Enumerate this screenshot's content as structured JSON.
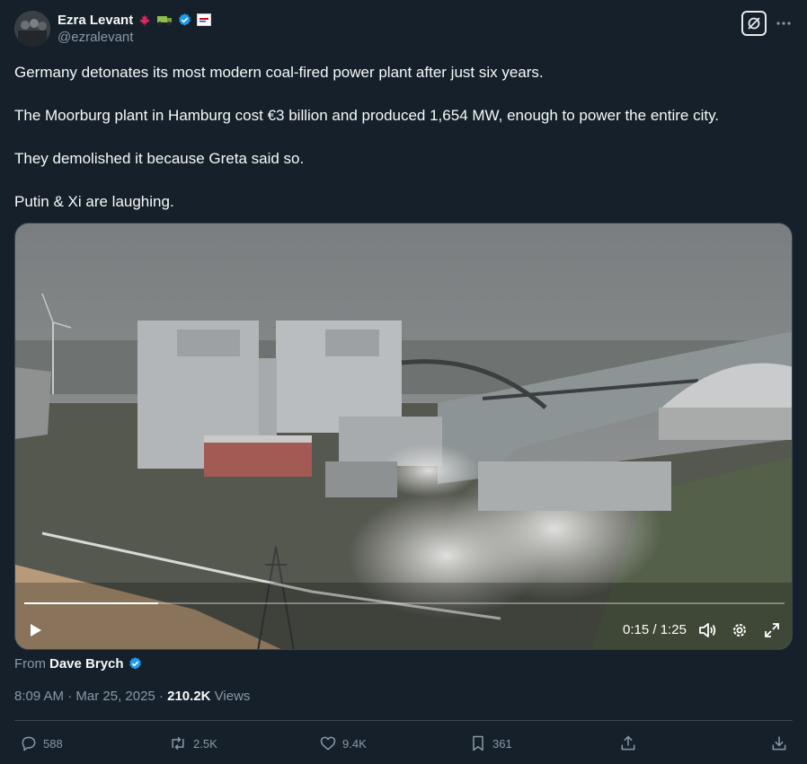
{
  "author": {
    "display_name": "Ezra Levant",
    "handle": "@ezralevant",
    "verified": true,
    "badges": [
      "maple-leaf-icon",
      "truck-icon",
      "verified-badge-icon",
      "flag-badge-icon"
    ]
  },
  "tweet": {
    "paragraphs": [
      "Germany detonates its most modern coal-fired power plant after just six years.",
      "The Moorburg plant in Hamburg cost €3 billion and produced 1,654 MW, enough to power the entire city.",
      "They demolished it because Greta said so.",
      "Putin & Xi are laughing."
    ]
  },
  "video": {
    "current_time": "0:15",
    "separator": " / ",
    "duration": "1:25",
    "progress": 0.176,
    "controls": [
      "play-icon",
      "volume-icon",
      "settings-icon",
      "fullscreen-icon"
    ]
  },
  "attribution": {
    "prefix": "From",
    "source_author": "Dave Brych",
    "verified": true
  },
  "meta": {
    "time": "8:09 AM",
    "dot": " · ",
    "date": "Mar 25, 2025",
    "views_count": "210.2K",
    "views_label": "Views"
  },
  "actions": {
    "replies": "588",
    "reposts": "2.5K",
    "likes": "9.4K",
    "bookmarks": "361"
  },
  "colors": {
    "background": "#15202b",
    "text_primary": "#f7f9f9",
    "text_secondary": "#8b98a5",
    "verified_blue": "#1d9bf0",
    "divider": "#38444d"
  }
}
